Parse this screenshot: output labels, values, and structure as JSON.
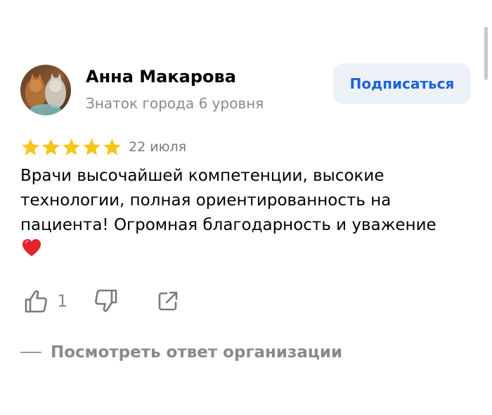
{
  "author": {
    "name": "Анна Макарова",
    "level": "Знаток города 6 уровня",
    "avatar_icon": "cats-avatar"
  },
  "subscribe_label": "Подписаться",
  "review": {
    "rating": 5,
    "rating_max": 5,
    "date": "22 июля",
    "text": "Врачи высочайшей компетенции, высокие технологии, полная ориентированность на пациента! Огромная благодарность и уважение",
    "emoji_icon": "red-heart-icon"
  },
  "actions": {
    "like_count": "1",
    "like_icon": "thumbs-up-icon",
    "dislike_icon": "thumbs-down-icon",
    "share_icon": "share-icon"
  },
  "org_answer_label": "Посмотреть ответ организации",
  "colors": {
    "accent": "#1e63d6",
    "star": "#f5c518",
    "muted": "#8a8a8a",
    "button_bg": "#edf2f9",
    "heart": "#e3242b"
  }
}
